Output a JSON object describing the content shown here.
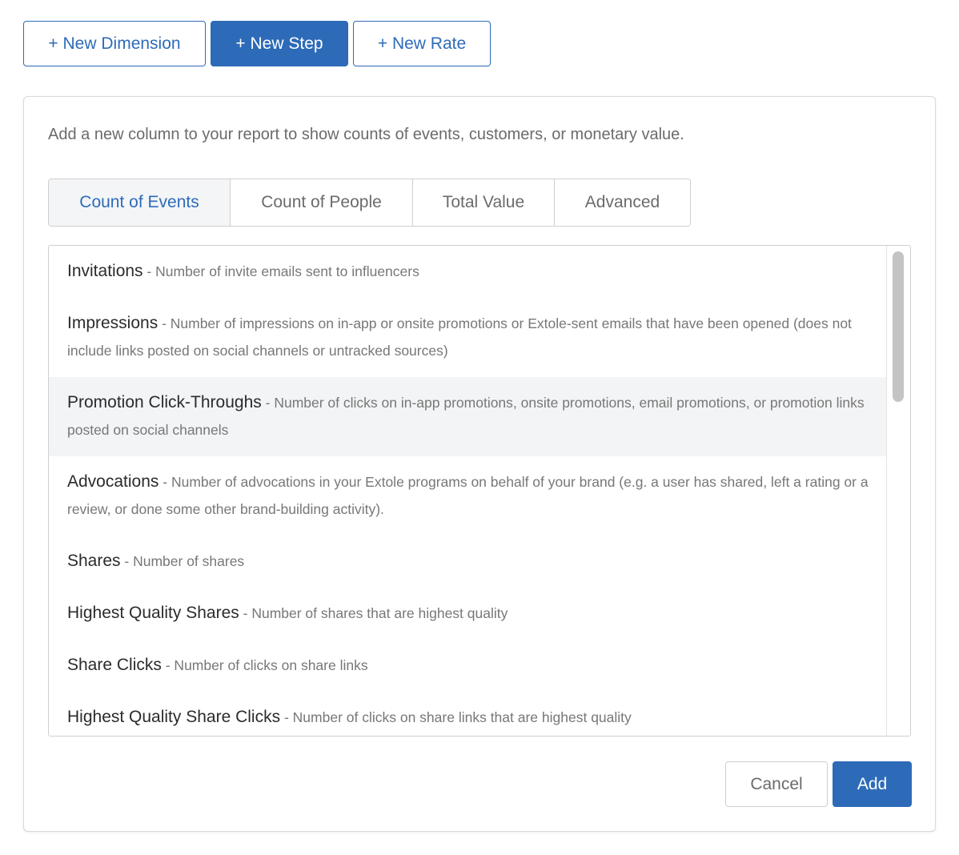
{
  "toolbar": {
    "new_dimension": "+ New Dimension",
    "new_step": "+ New Step",
    "new_rate": "+ New Rate"
  },
  "panel": {
    "intro": "Add a new column to your report to show counts of events, customers, or monetary value.",
    "tabs": [
      {
        "label": "Count of Events",
        "active": true
      },
      {
        "label": "Count of People",
        "active": false
      },
      {
        "label": "Total Value",
        "active": false
      },
      {
        "label": "Advanced",
        "active": false
      }
    ],
    "items": [
      {
        "name": "Invitations",
        "desc": " - Number of invite emails sent to influencers"
      },
      {
        "name": "Impressions",
        "desc": " - Number of impressions on in-app or onsite promotions or Extole-sent emails that have been opened (does not include links posted on social channels or untracked sources)"
      },
      {
        "name": "Promotion Click-Throughs",
        "desc": " - Number of clicks on in-app promotions, onsite promotions, email promotions, or promotion links posted on social channels"
      },
      {
        "name": "Advocations",
        "desc": " - Number of advocations in your Extole programs on behalf of your brand (e.g. a user has shared, left a rating or a review, or done some other brand-building activity)."
      },
      {
        "name": "Shares",
        "desc": " - Number of shares"
      },
      {
        "name": "Highest Quality Shares",
        "desc": " - Number of shares that are highest quality"
      },
      {
        "name": "Share Clicks",
        "desc": " - Number of clicks on share links"
      },
      {
        "name": "Highest Quality Share Clicks",
        "desc": " - Number of clicks on share links that are highest quality"
      }
    ],
    "cancel": "Cancel",
    "add": "Add"
  },
  "colors": {
    "accent": "#2d6bb8",
    "highlight_row": "#f3f4f6"
  }
}
